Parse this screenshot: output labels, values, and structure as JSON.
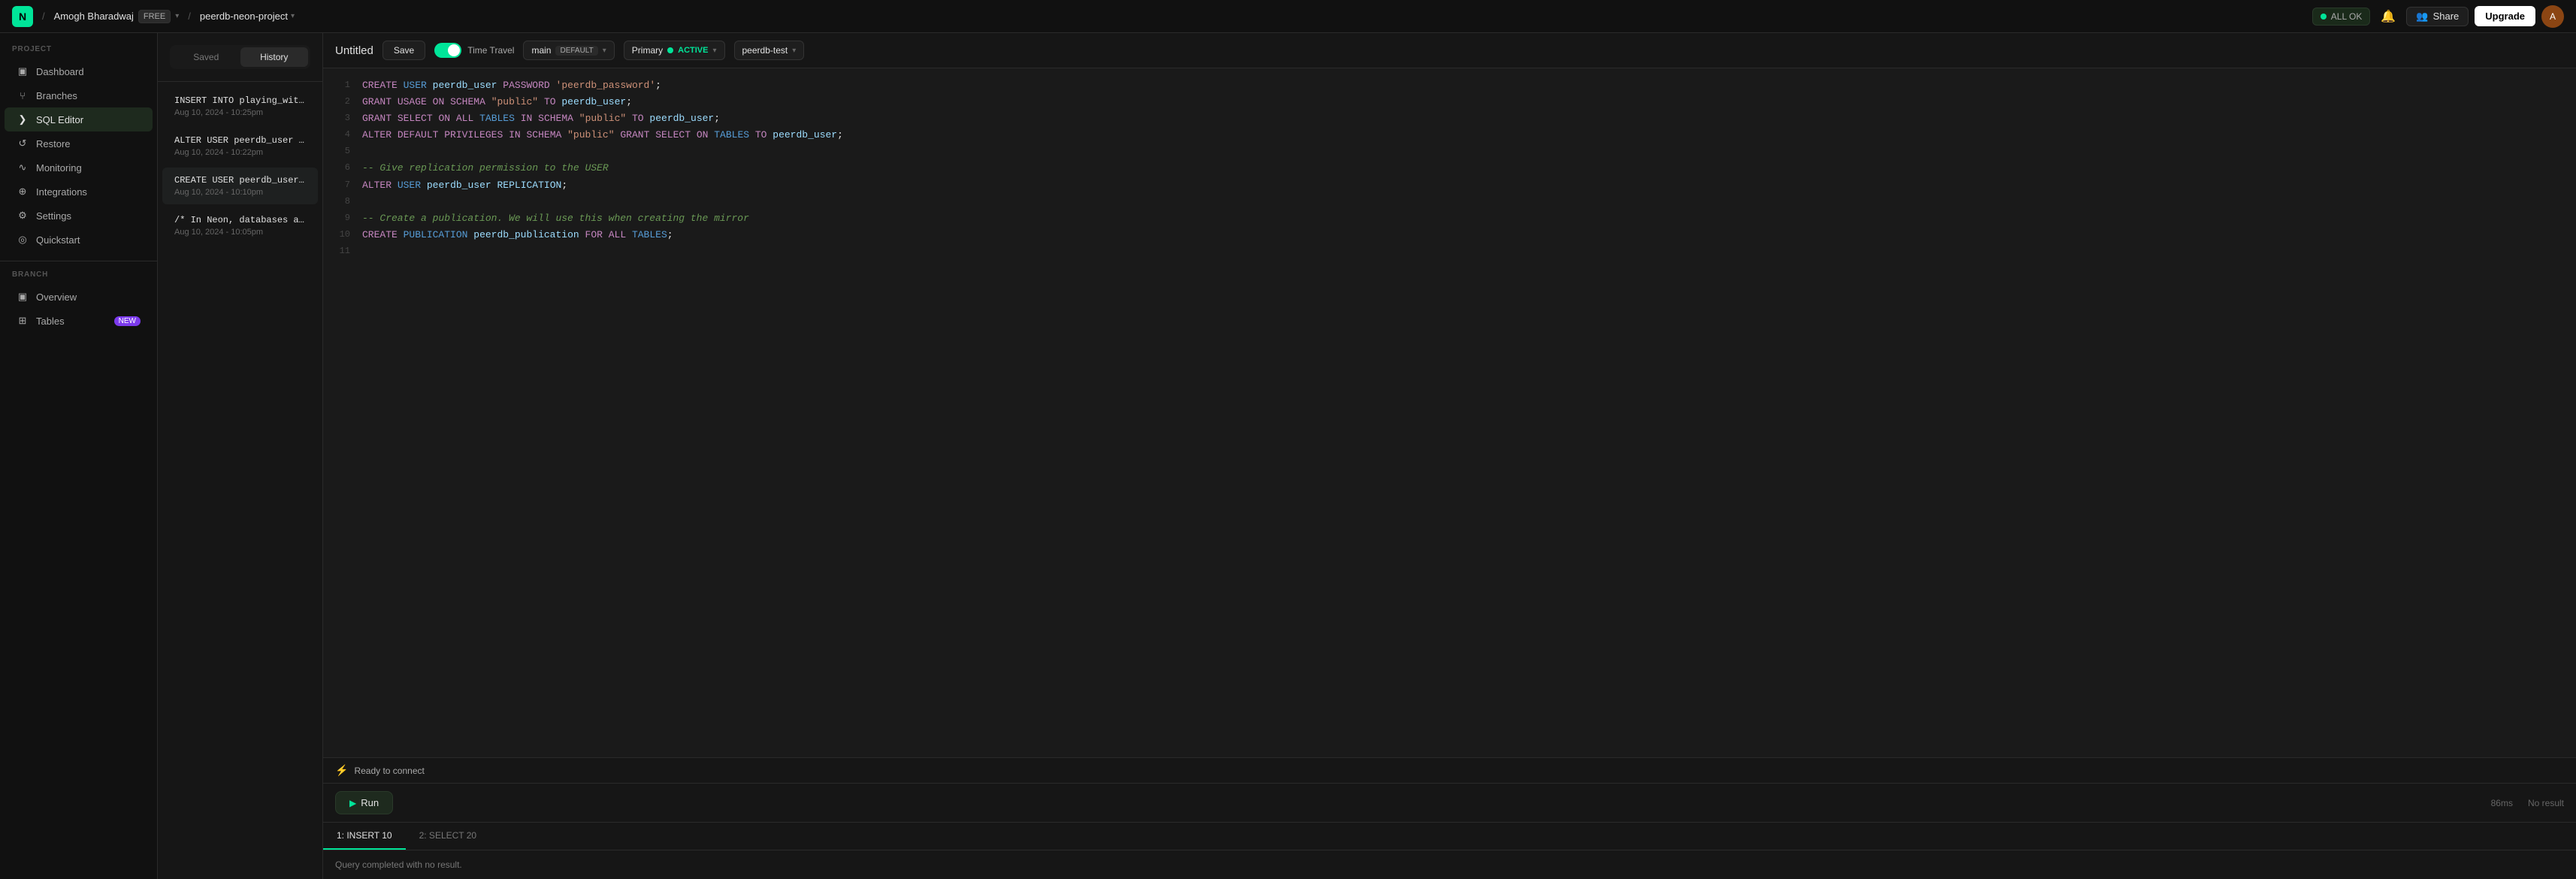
{
  "topnav": {
    "logo": "N",
    "user": {
      "name": "Amogh Bharadwaj",
      "plan": "FREE"
    },
    "project": "peerdb-neon-project",
    "status": "ALL OK",
    "share_label": "Share",
    "upgrade_label": "Upgrade"
  },
  "sidebar": {
    "project_section": "PROJECT",
    "branch_section": "BRANCH",
    "items": [
      {
        "id": "dashboard",
        "label": "Dashboard",
        "icon": "▣"
      },
      {
        "id": "branches",
        "label": "Branches",
        "icon": "⑂"
      },
      {
        "id": "sql-editor",
        "label": "SQL Editor",
        "icon": "❯"
      },
      {
        "id": "restore",
        "label": "Restore",
        "icon": "↺"
      },
      {
        "id": "monitoring",
        "label": "Monitoring",
        "icon": "∿"
      },
      {
        "id": "integrations",
        "label": "Integrations",
        "icon": "⊕"
      },
      {
        "id": "settings",
        "label": "Settings",
        "icon": "⚙"
      },
      {
        "id": "quickstart",
        "label": "Quickstart",
        "icon": "◎"
      }
    ],
    "branch_items": [
      {
        "id": "overview",
        "label": "Overview",
        "icon": "▣"
      },
      {
        "id": "tables",
        "label": "Tables",
        "icon": "⊞",
        "badge": "NEW"
      }
    ]
  },
  "history_panel": {
    "tabs": [
      {
        "id": "saved",
        "label": "Saved"
      },
      {
        "id": "history",
        "label": "History"
      }
    ],
    "active_tab": "history",
    "items": [
      {
        "title": "INSERT INTO playing_wit...",
        "date": "Aug 10, 2024 - 10:25pm",
        "active": false
      },
      {
        "title": "ALTER USER peerdb_user ...",
        "date": "Aug 10, 2024 - 10:22pm",
        "active": false
      },
      {
        "title": "CREATE USER peerdb_user...",
        "date": "Aug 10, 2024 - 10:10pm",
        "active": true
      },
      {
        "title": "/* In Neon, databases a...",
        "date": "Aug 10, 2024 - 10:05pm",
        "active": false
      }
    ]
  },
  "editor": {
    "title": "Untitled",
    "save_label": "Save",
    "time_travel_label": "Time Travel",
    "branch": {
      "name": "main",
      "badge": "DEFAULT"
    },
    "compute": {
      "name": "Primary",
      "status": "ACTIVE"
    },
    "database": "peerdb-test",
    "lines": [
      {
        "num": "1",
        "code": "CREATE USER peerdb_user PASSWORD 'peerdb_password';"
      },
      {
        "num": "2",
        "code": "GRANT USAGE ON SCHEMA \"public\" TO peerdb_user;"
      },
      {
        "num": "3",
        "code": "GRANT SELECT ON ALL TABLES IN SCHEMA \"public\" TO peerdb_user;"
      },
      {
        "num": "4",
        "code": "ALTER DEFAULT PRIVILEGES IN SCHEMA \"public\" GRANT SELECT ON TABLES TO peerdb_user;"
      },
      {
        "num": "5",
        "code": ""
      },
      {
        "num": "6",
        "code": "-- Give replication permission to the USER"
      },
      {
        "num": "7",
        "code": "ALTER USER peerdb_user REPLICATION;"
      },
      {
        "num": "8",
        "code": ""
      },
      {
        "num": "9",
        "code": "-- Create a publication. We will use this when creating the mirror"
      },
      {
        "num": "10",
        "code": "CREATE PUBLICATION peerdb_publication FOR ALL TABLES;"
      },
      {
        "num": "11",
        "code": ""
      }
    ],
    "status": "Ready to connect",
    "run_label": "Run",
    "result_tabs": [
      {
        "id": "insert",
        "label": "1: INSERT 10"
      },
      {
        "id": "select",
        "label": "2: SELECT 20"
      }
    ],
    "active_result_tab": "insert",
    "query_result": "Query completed with no result.",
    "run_time": "86ms",
    "run_result": "No result"
  }
}
